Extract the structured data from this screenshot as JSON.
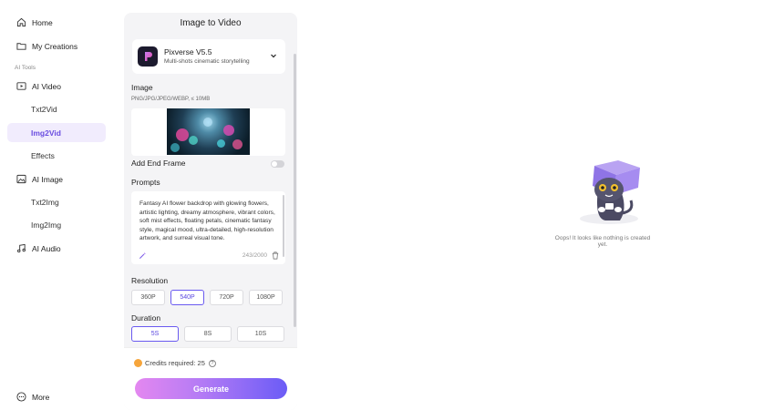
{
  "sidebar": {
    "home": "Home",
    "my_creations": "My Creations",
    "section_label": "AI Tools",
    "ai_video": "AI Video",
    "txt2vid": "Txt2Vid",
    "img2vid": "Img2Vid",
    "effects": "Effects",
    "ai_image": "AI Image",
    "txt2img": "Txt2Img",
    "img2img": "Img2Img",
    "ai_audio": "AI Audio",
    "more": "More"
  },
  "panel": {
    "title": "Image to Video",
    "model": {
      "name": "Pixverse V5.5",
      "description": "Multi-shots cinematic storytelling"
    },
    "image": {
      "label": "Image",
      "hint": "PNG/JPG/JPEG/WEBP, ≤ 10MB"
    },
    "end_frame_label": "Add End Frame",
    "end_frame_enabled": false,
    "prompts": {
      "label": "Prompts",
      "text": "Fantasy AI flower backdrop with glowing flowers, artistic lighting, dreamy atmosphere, vibrant colors, soft mist effects, floating petals, cinematic fantasy style, magical mood, ultra-detailed, high-resolution artwork, and surreal visual tone.",
      "counter": "243/2000"
    },
    "resolution": {
      "label": "Resolution",
      "options": [
        "360P",
        "540P",
        "720P",
        "1080P"
      ],
      "selected": "540P"
    },
    "duration": {
      "label": "Duration",
      "options": [
        "5S",
        "8S",
        "10S"
      ],
      "selected": "5S"
    },
    "credits": "Credits required: 25",
    "generate_label": "Generate"
  },
  "empty_state": {
    "message": "Oops! It looks like nothing is created yet."
  },
  "colors": {
    "accent": "#6a4de0",
    "active_bg": "#f1ecfd",
    "generate_start": "#e488f0",
    "generate_end": "#6b5cf6"
  },
  "icons": [
    "home-icon",
    "folder-icon",
    "video-icon",
    "image-icon",
    "music-icon",
    "more-icon",
    "chevron-down-icon",
    "magic-wand-icon",
    "trash-icon",
    "coin-icon",
    "help-icon"
  ]
}
